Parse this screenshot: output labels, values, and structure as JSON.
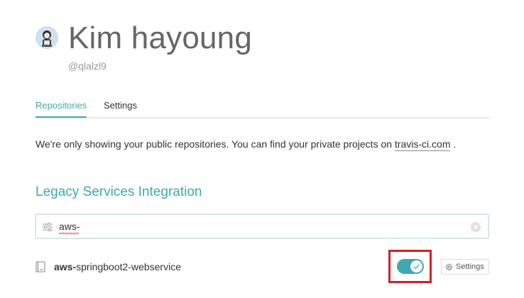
{
  "profile": {
    "name": "Kim hayoung",
    "handle": "@qlalzl9"
  },
  "tabs": [
    {
      "label": "Repositories",
      "active": true
    },
    {
      "label": "Settings",
      "active": false
    }
  ],
  "notice": {
    "text": "We're only showing your public repositories. You can find your private projects on",
    "link_text": "travis-ci.com",
    "suffix": "."
  },
  "section": {
    "title": "Legacy Services Integration"
  },
  "search": {
    "value": "aws-",
    "placeholder": ""
  },
  "repositories": [
    {
      "name_match": "aws-",
      "name_rest": "springboot2-webservice",
      "enabled": true,
      "settings_label": "Settings"
    }
  ],
  "colors": {
    "accent": "#3eaaaf",
    "highlight": "#d0202a"
  },
  "icons": {
    "filter": "filter-sliders-icon",
    "clear": "clear-circle-icon",
    "repo": "repo-book-icon",
    "toggle_check": "check-icon",
    "settings": "gear-icon"
  }
}
